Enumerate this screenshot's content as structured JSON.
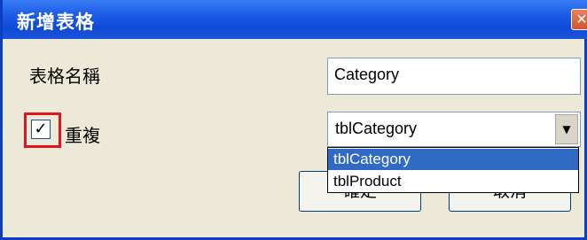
{
  "dialog": {
    "title": "新增表格",
    "close_glyph": "✕"
  },
  "form": {
    "table_name_label": "表格名稱",
    "table_name_value": "Category",
    "repeat_label": "重複",
    "repeat_checked": true,
    "check_glyph": "✓",
    "combo_value": "tblCategory",
    "combo_arrow_glyph": "▼",
    "dropdown_options": [
      "tblCategory",
      "tblProduct"
    ],
    "selected_option_index": 0
  },
  "buttons": {
    "ok_label": "確定",
    "cancel_label": "取消"
  },
  "colors": {
    "titlebar": "#0f4ad8",
    "highlight": "#e1151b",
    "selection": "#316ac5"
  },
  "icons": {
    "close": "close-icon",
    "checkbox": "checkmark-icon",
    "combo_arrow": "chevron-down-icon"
  }
}
